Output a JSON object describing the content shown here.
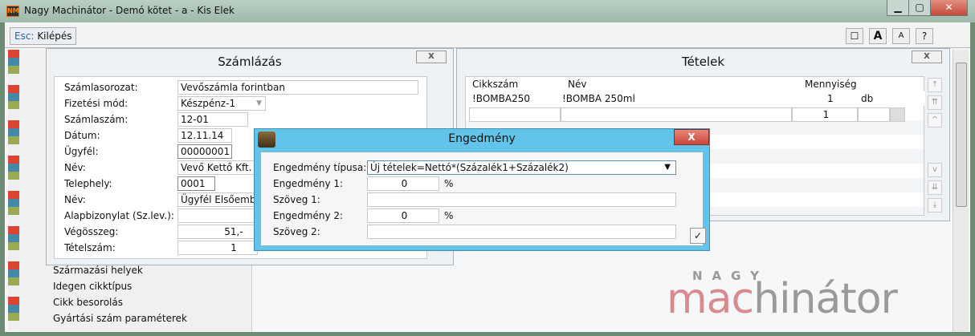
{
  "window": {
    "title": "Nagy Machinátor - Demó kötet - a - Kis Elek",
    "app_icon": "NM",
    "minimize": "▁",
    "maximize": "▢",
    "close": "✕"
  },
  "toolbar": {
    "esc_key": "Esc:",
    "esc_label": "Kilépés",
    "btn_window": "☐",
    "btn_font_large": "A",
    "btn_font_small": "A",
    "btn_help": "?"
  },
  "invoice": {
    "title": "Számlázás",
    "close": "X",
    "fields": [
      {
        "label": "Számlasorozat:",
        "value": "Vevőszámla forintban"
      },
      {
        "label": "Fizetési mód:",
        "value": "Készpénz-1"
      },
      {
        "label": "Számlaszám:",
        "value": "12-01"
      },
      {
        "label": "Dátum:",
        "value": "12.11.14"
      },
      {
        "label": "Ügyfél:",
        "value": "00000001"
      },
      {
        "label": "Név:",
        "value": "Vevő Kettő Kft."
      },
      {
        "label": "Telephely:",
        "value": "0001"
      },
      {
        "label": "Név:",
        "value": "Ügyfél Elsőember"
      },
      {
        "label": "Alapbizonylat (Sz.lev.):",
        "value": ""
      },
      {
        "label": "Végösszeg:",
        "value": "51,-"
      },
      {
        "label": "Tételszám:",
        "value": "1"
      }
    ]
  },
  "side_list": [
    "Származási helyek",
    "Idegen cikktípus",
    "Cikk besorolás",
    "Gyártási szám paraméterek"
  ],
  "items": {
    "title": "Tételek",
    "close": "X",
    "columns": [
      "Cikkszám",
      "Név",
      "Mennyiség"
    ],
    "rows": [
      {
        "code": "!BOMBA250",
        "name": "!BOMBA 250ml",
        "qty": "1",
        "unit": "db"
      }
    ],
    "new_row": {
      "code": "",
      "name": "",
      "qty": "1",
      "unit": ""
    }
  },
  "discount": {
    "title": "Engedmény",
    "close": "X",
    "type_label": "Engedmény típusa:",
    "type_value": "Új tételek=Nettó*(Százalék1+Százalék2)",
    "d1_label": "Engedmény 1:",
    "d1_value": "0",
    "d1_unit": "%",
    "t1_label": "Szöveg 1:",
    "t1_value": "",
    "d2_label": "Engedmény 2:",
    "d2_value": "0",
    "d2_unit": "%",
    "t2_label": "Szöveg 2:",
    "t2_value": "",
    "ok": "✓"
  },
  "logo": {
    "top": "NAGY",
    "main_a": "mac",
    "main_b": "hinátor"
  }
}
